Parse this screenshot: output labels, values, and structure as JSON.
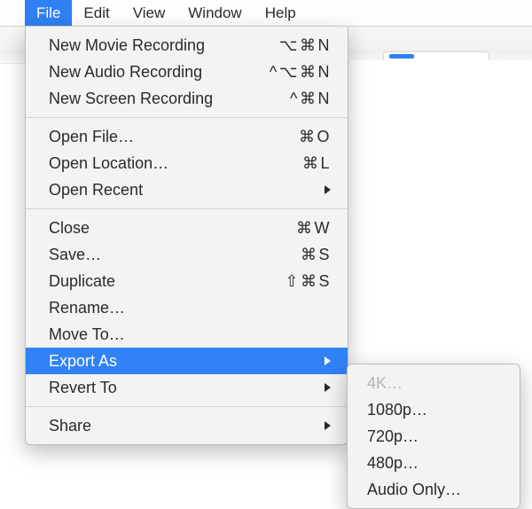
{
  "menubar": {
    "items": [
      {
        "label": "File",
        "selected": true
      },
      {
        "label": "Edit",
        "selected": false
      },
      {
        "label": "View",
        "selected": false
      },
      {
        "label": "Window",
        "selected": false
      },
      {
        "label": "Help",
        "selected": false
      }
    ]
  },
  "colors": {
    "highlight": "#3082f6"
  },
  "file_menu": {
    "groups": [
      [
        {
          "label": "New Movie Recording",
          "shortcut": "⌥⌘N",
          "submenu": false
        },
        {
          "label": "New Audio Recording",
          "shortcut": "^⌥⌘N",
          "submenu": false
        },
        {
          "label": "New Screen Recording",
          "shortcut": "^⌘N",
          "submenu": false
        }
      ],
      [
        {
          "label": "Open File…",
          "shortcut": "⌘O",
          "submenu": false
        },
        {
          "label": "Open Location…",
          "shortcut": "⌘L",
          "submenu": false
        },
        {
          "label": "Open Recent",
          "shortcut": "",
          "submenu": true
        }
      ],
      [
        {
          "label": "Close",
          "shortcut": "⌘W",
          "submenu": false
        },
        {
          "label": "Save…",
          "shortcut": "⌘S",
          "submenu": false
        },
        {
          "label": "Duplicate",
          "shortcut": "⇧⌘S",
          "submenu": false
        },
        {
          "label": "Rename…",
          "shortcut": "",
          "submenu": false
        },
        {
          "label": "Move To…",
          "shortcut": "",
          "submenu": false
        },
        {
          "label": "Export As",
          "shortcut": "",
          "submenu": true,
          "highlighted": true
        },
        {
          "label": "Revert To",
          "shortcut": "",
          "submenu": true
        }
      ],
      [
        {
          "label": "Share",
          "shortcut": "",
          "submenu": true
        }
      ]
    ]
  },
  "export_as_submenu": {
    "items": [
      {
        "label": "4K…",
        "disabled": true
      },
      {
        "label": "1080p…",
        "disabled": false
      },
      {
        "label": "720p…",
        "disabled": false
      },
      {
        "label": "480p…",
        "disabled": false
      },
      {
        "label": "Audio Only…",
        "disabled": false
      }
    ]
  }
}
